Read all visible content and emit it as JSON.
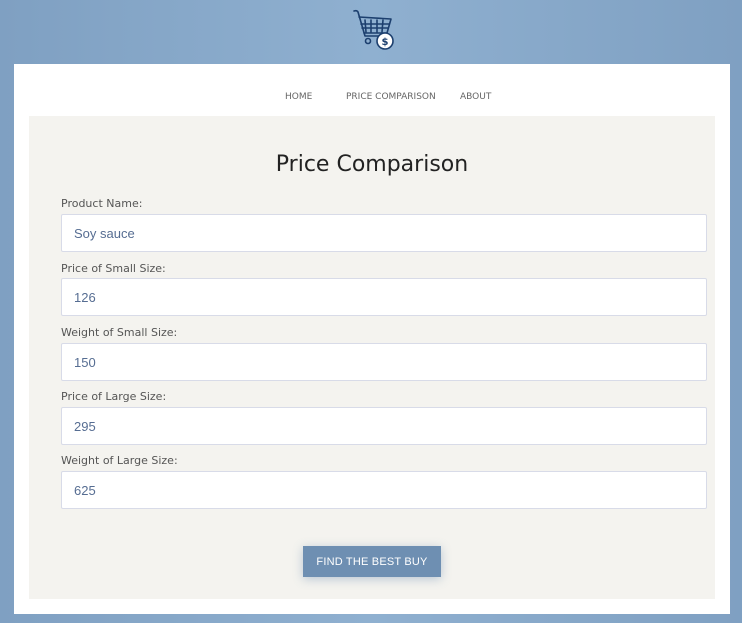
{
  "nav": {
    "home": "HOME",
    "price_comparison": "PRICE COMPARISON",
    "about": "ABOUT"
  },
  "page_title": "Price Comparison",
  "form": {
    "product_name": {
      "label": "Product Name:",
      "value": "Soy sauce"
    },
    "price_small": {
      "label": "Price of Small Size:",
      "value": "126"
    },
    "weight_small": {
      "label": "Weight of Small Size:",
      "value": "150"
    },
    "price_large": {
      "label": "Price of Large Size:",
      "value": "295"
    },
    "weight_large": {
      "label": "Weight of Large Size:",
      "value": "625"
    }
  },
  "submit_label": "FIND THE BEST BUY",
  "logo": {
    "icon": "shopping-cart-dollar-icon",
    "color": "#1c3f6e"
  },
  "colors": {
    "background": "#8aaacb",
    "button": "#6e8fb2",
    "panel": "#f4f3ef"
  }
}
